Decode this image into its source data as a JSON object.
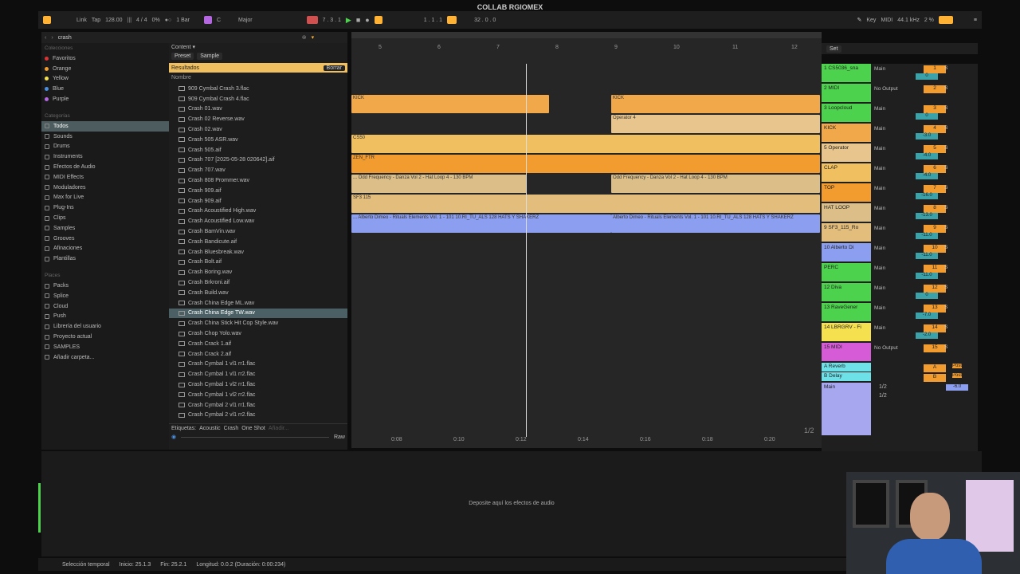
{
  "window_title": "COLLAB RGIOMEX",
  "transport": {
    "link": "Link",
    "tap": "Tap",
    "tempo": "128.00",
    "time_sig": "4 / 4",
    "cpu_pct": "0%",
    "quantize": "1 Bar",
    "key_root": "C",
    "scale": "Major",
    "position": "7 .   3 .   1",
    "loop_start": "1 .   1 .   1",
    "loop_length": "32 .   0 .   0",
    "key_label": "Key",
    "midi_label": "MIDI",
    "sample_rate": "44.1 kHz",
    "cpu_load": "2 %"
  },
  "browser": {
    "search_value": "crash",
    "collections_head": "Colecciones",
    "collections": [
      {
        "label": "Favoritos",
        "color": "#d33"
      },
      {
        "label": "Orange",
        "color": "#f29b2f"
      },
      {
        "label": "Yellow",
        "color": "#f5e050"
      },
      {
        "label": "Blue",
        "color": "#4a8fe0"
      },
      {
        "label": "Purple",
        "color": "#b467e0"
      }
    ],
    "categories_head": "Categorías",
    "categories": [
      "Todos",
      "Sounds",
      "Drums",
      "Instruments",
      "Efectos de Audio",
      "MIDI Effects",
      "Moduladores",
      "Max for Live",
      "Plug-Ins",
      "Clips",
      "Samples",
      "Grooves",
      "Afinaciones",
      "Plantillas"
    ],
    "places_head": "Places",
    "places": [
      "Packs",
      "Splice",
      "Cloud",
      "Push",
      "Librería del usuario",
      "Proyecto actual",
      "SAMPLES",
      "Añadir carpeta..."
    ],
    "content_label": "Content ▾",
    "filter_preset": "Preset",
    "filter_sample": "Sample",
    "results_label": "Resultados",
    "clear_label": "Borrar",
    "col_name": "Nombre",
    "files": [
      "909 Cymbal Crash 3.flac",
      "909 Cymbal Crash 4.flac",
      "Crash 01.wav",
      "Crash 02 Reverse.wav",
      "Crash 02.wav",
      "Crash 505 ASR.wav",
      "Crash 505.aif",
      "Crash 707 [2025-05-28 020642].aif",
      "Crash 707.wav",
      "Crash 808 Prommer.wav",
      "Crash 909.aif",
      "Crash 909.aif",
      "Crash Acoustified High.wav",
      "Crash Acoustified Low.wav",
      "Crash BamVin.wav",
      "Crash Bandicute.aif",
      "Crash Bluesbreak.wav",
      "Crash Bolt.aif",
      "Crash Boring.wav",
      "Crash Brkroni.aif",
      "Crash Build.wav",
      "Crash China Edge ML.wav",
      "Crash China Edge TW.wav",
      "Crash China Stick Hit Cop Style.wav",
      "Crash Chop Yolo.wav",
      "Crash Crack 1.aif",
      "Crash Crack 2.aif",
      "Crash Cymbal 1 vl1 rr1.flac",
      "Crash Cymbal 1 vl1 rr2.flac",
      "Crash Cymbal 1 vl2 rr1.flac",
      "Crash Cymbal 1 vl2 rr2.flac",
      "Crash Cymbal 2 vl1 rr1.flac",
      "Crash Cymbal 2 vl1 rr2.flac"
    ],
    "selected_file_index": 22,
    "tags_label": "Etiquetas:",
    "tags": [
      "Acoustic",
      "Crash",
      "One Shot"
    ],
    "tag_add": "Añadir...",
    "raw_label": "Raw"
  },
  "arrangement": {
    "bars": [
      "5",
      "6",
      "7",
      "8",
      "9",
      "10",
      "11",
      "12"
    ],
    "times": [
      "0:08",
      "0:10",
      "0:12",
      "0:14",
      "0:16",
      "0:18",
      "0:20"
    ],
    "page_indicator": "1/2",
    "set_label": "Set",
    "zoom": "100%",
    "clip_labels": {
      "kick": "KICK",
      "operator": "Operator 4",
      "clap": "CS50",
      "top": "ZEN_FTR",
      "hat_a": "... Odd Frequency - Danza Vol 2 - Hat Loop 4 - 130 BPM",
      "hat_b": "Odd Frequency - Danza Vol 2 - Hat Loop 4 - 130 BPM",
      "sf": "SF3  115",
      "alberto_a": "... Alberto Dimeo - Rituals Elements Vol. 1 - 101 10.RI_TU_ALS 128 HATS Y SHAKERZ",
      "alberto_b": "Alberto Dimeo - Rituals Elements Vol. 1 - 101 10.RI_TU_ALS 128 HATS Y SHAKERZ"
    }
  },
  "tracks": [
    {
      "name": "1 CS5036_sna",
      "color": "#4cd24c",
      "out": "Main",
      "num": "1",
      "vol": "0"
    },
    {
      "name": "2 MIDI",
      "color": "#4cd24c",
      "out": "No Output",
      "num": "2",
      "vol": ""
    },
    {
      "name": "3 Loopcloud",
      "color": "#4cd24c",
      "out": "Main",
      "num": "3",
      "vol": "0"
    },
    {
      "name": "KICK",
      "color": "#f0a84b",
      "out": "Main",
      "num": "4",
      "vol": "-3.0"
    },
    {
      "name": "5 Operator",
      "color": "#e8c58c",
      "out": "Main",
      "num": "5",
      "vol": "-4.0"
    },
    {
      "name": "CLAP",
      "color": "#f0c060",
      "out": "Main",
      "num": "6",
      "vol": "-4.0"
    },
    {
      "name": "TOP",
      "color": "#f29b2f",
      "out": "Main",
      "num": "7",
      "vol": "-16.0"
    },
    {
      "name": "HAT LOOP",
      "color": "#dcbf88",
      "out": "Main",
      "num": "8",
      "vol": "-13.0"
    },
    {
      "name": "9 SF3_115_Ro",
      "color": "#e2bd7c",
      "out": "Main",
      "num": "9",
      "vol": "-11.0"
    },
    {
      "name": "10 Alberto Di",
      "color": "#8c9ef0",
      "out": "Main",
      "num": "10",
      "vol": "-11.0"
    },
    {
      "name": "PERC",
      "color": "#4cd24c",
      "out": "Main",
      "num": "11",
      "vol": "-11.0"
    },
    {
      "name": "12 Diva",
      "color": "#4cd24c",
      "out": "Main",
      "num": "12",
      "vol": "0"
    },
    {
      "name": "13 RaveGener",
      "color": "#4cd24c",
      "out": "Main",
      "num": "13",
      "vol": "-7.0"
    },
    {
      "name": "14 LBRGRV - Fi",
      "color": "#f5e050",
      "out": "Main",
      "num": "14",
      "vol": "-2.0"
    },
    {
      "name": "15 MIDI",
      "color": "#d65bd6",
      "out": "No Output",
      "num": "15",
      "vol": ""
    }
  ],
  "returns": [
    {
      "name": "A Reverb",
      "color": "#6ee0e8",
      "num": "A",
      "post": "Post"
    },
    {
      "name": "B Delay",
      "color": "#6ee0e8",
      "num": "B",
      "post": "Post"
    }
  ],
  "master": {
    "name": "Main",
    "color": "#a7a7f0",
    "sel_a": "1/2",
    "sel_b": "1/2",
    "vol": "-6.0"
  },
  "detail": {
    "drop_hint": "Deposite aquí los efectos de audio"
  },
  "status": {
    "mode": "Selección temporal",
    "start": "Inicio: 25.1.3",
    "end": "Fin: 25.2.1",
    "length": "Longitud: 0.0.2 (Duración: 0:00:234)"
  }
}
